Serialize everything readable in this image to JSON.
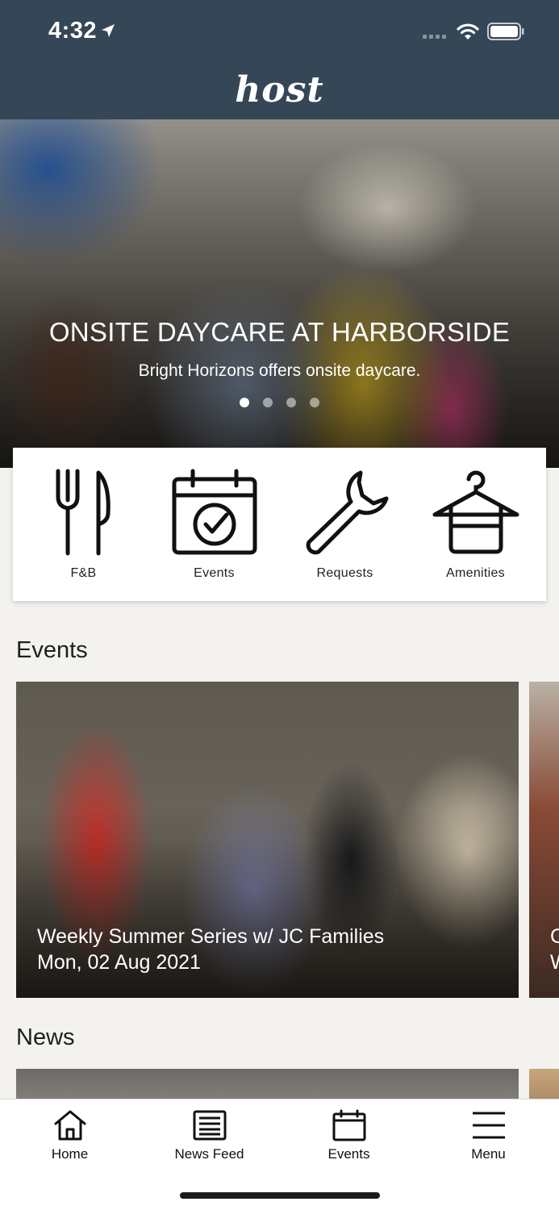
{
  "status_bar": {
    "time": "4:32"
  },
  "header": {
    "logo_text": "host"
  },
  "hero": {
    "title": "ONSITE DAYCARE AT HARBORSIDE",
    "subtitle": "Bright Horizons offers onsite daycare.",
    "slide_count": 4,
    "active_slide": 1
  },
  "quick_actions": [
    {
      "label": "F&B",
      "icon": "fork-knife-icon"
    },
    {
      "label": "Events",
      "icon": "calendar-check-icon"
    },
    {
      "label": "Requests",
      "icon": "wrench-icon"
    },
    {
      "label": "Amenities",
      "icon": "towel-hanger-icon"
    }
  ],
  "events_section": {
    "title": "Events",
    "cards": [
      {
        "title": "Weekly Summer Series w/ JC Families",
        "date": "Mon, 02 Aug 2021"
      },
      {
        "title_peek": "C",
        "date_peek": "W"
      }
    ]
  },
  "news_section": {
    "title": "News"
  },
  "tabbar": {
    "items": [
      {
        "label": "Home",
        "icon": "home-icon"
      },
      {
        "label": "News Feed",
        "icon": "newspaper-icon"
      },
      {
        "label": "Events",
        "icon": "calendar-icon"
      },
      {
        "label": "Menu",
        "icon": "hamburger-menu-icon"
      }
    ]
  },
  "colors": {
    "header_bg": "#354657",
    "page_bg": "#f3f2ef",
    "card_bg": "#ffffff"
  }
}
